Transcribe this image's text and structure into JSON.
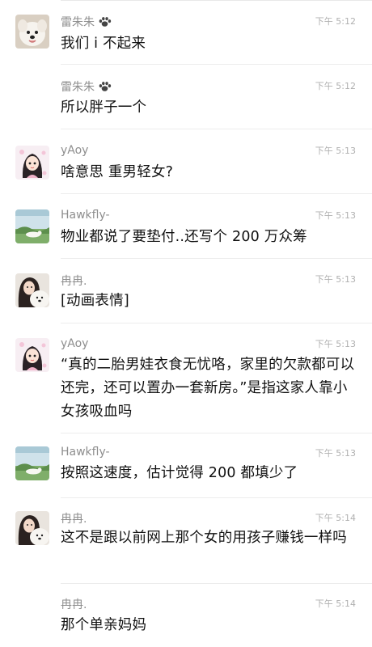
{
  "messages": [
    {
      "name": "雷朱朱",
      "name_icon": "paw-icon",
      "time": "下午 5:12",
      "text": "我们 i 不起来",
      "avatar": "dog-avatar"
    },
    {
      "name": "雷朱朱",
      "name_icon": "paw-icon",
      "time": "下午 5:12",
      "text": "所以胖子一个",
      "avatar": ""
    },
    {
      "name": "yAoy",
      "time": "下午 5:13",
      "text": "啥意思 重男轻女?",
      "avatar": "cartoon-girl-avatar"
    },
    {
      "name": "Hawkfly-",
      "time": "下午 5:13",
      "text": "物业都说了要垫付..还写个 200 万众筹",
      "avatar": "landscape-avatar"
    },
    {
      "name": "冉冉.",
      "time": "下午 5:13",
      "text": "[动画表情]",
      "avatar": "girl-with-dog-avatar"
    },
    {
      "name": "yAoy",
      "time": "下午 5:13",
      "text": "“真的二胎男娃衣食无忧咯，家里的欠款都可以还完，还可以置办一套新房。”是指这家人靠小女孩吸血吗",
      "avatar": "cartoon-girl-avatar"
    },
    {
      "name": "Hawkfly-",
      "time": "下午 5:13",
      "text": "按照这速度，估计觉得 200 都填少了",
      "avatar": "landscape-avatar"
    },
    {
      "name": "冉冉.",
      "time": "下午 5:14",
      "text": "这不是跟以前网上那个女的用孩子赚钱一样吗",
      "avatar": "girl-with-dog-avatar"
    },
    {
      "name": "冉冉.",
      "time": "下午 5:14",
      "text": "那个单亲妈妈",
      "avatar": ""
    }
  ]
}
